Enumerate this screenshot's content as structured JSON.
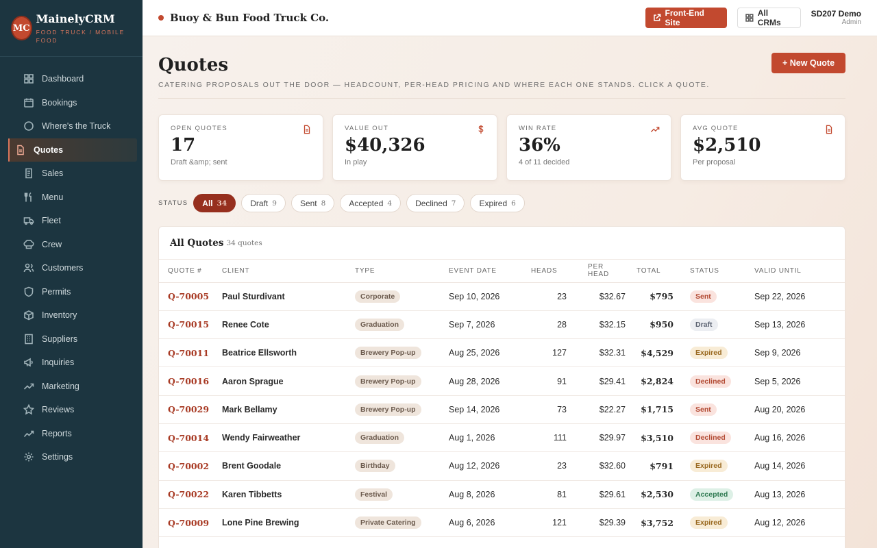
{
  "brand": {
    "logo": "MC",
    "name": "MainelyCRM",
    "subtitle": "Food Truck / Mobile Food"
  },
  "nav": [
    {
      "label": "Dashboard",
      "icon": "grid-icon"
    },
    {
      "label": "Bookings",
      "icon": "calendar-icon"
    },
    {
      "label": "Where's the Truck",
      "icon": "circle-icon"
    },
    {
      "label": "Quotes",
      "icon": "document-icon",
      "active": true
    },
    {
      "label": "Sales",
      "icon": "receipt-icon"
    },
    {
      "label": "Menu",
      "icon": "utensils-icon"
    },
    {
      "label": "Fleet",
      "icon": "truck-icon"
    },
    {
      "label": "Crew",
      "icon": "chef-hat-icon"
    },
    {
      "label": "Customers",
      "icon": "users-icon"
    },
    {
      "label": "Permits",
      "icon": "shield-icon"
    },
    {
      "label": "Inventory",
      "icon": "box-icon"
    },
    {
      "label": "Suppliers",
      "icon": "building-icon"
    },
    {
      "label": "Inquiries",
      "icon": "megaphone-icon"
    },
    {
      "label": "Marketing",
      "icon": "trend-icon"
    },
    {
      "label": "Reviews",
      "icon": "star-icon"
    },
    {
      "label": "Reports",
      "icon": "chart-icon"
    },
    {
      "label": "Settings",
      "icon": "gear-icon"
    }
  ],
  "topbar": {
    "business": "Buoy & Bun Food Truck Co.",
    "frontend_label": "Front-End Site",
    "allcrms_label": "All CRMs",
    "user_name": "SD207 Demo",
    "user_role": "Admin"
  },
  "page": {
    "title": "Quotes",
    "subtitle": "Catering proposals out the door — headcount, per-head pricing and where each one stands. Click a quote.",
    "new_button": "+ New Quote"
  },
  "stats": [
    {
      "label": "Open Quotes",
      "value": "17",
      "note": "Draft &amp; sent",
      "icon": "document-icon"
    },
    {
      "label": "Value Out",
      "value": "$40,326",
      "note": "In play",
      "icon": "dollar-icon"
    },
    {
      "label": "Win Rate",
      "value": "36%",
      "note": "4 of 11 decided",
      "icon": "trend-icon"
    },
    {
      "label": "Avg Quote",
      "value": "$2,510",
      "note": "Per proposal",
      "icon": "document-icon"
    }
  ],
  "filters": {
    "label": "STATUS",
    "items": [
      {
        "label": "All",
        "count": "34",
        "active": true
      },
      {
        "label": "Draft",
        "count": "9"
      },
      {
        "label": "Sent",
        "count": "8"
      },
      {
        "label": "Accepted",
        "count": "4"
      },
      {
        "label": "Declined",
        "count": "7"
      },
      {
        "label": "Expired",
        "count": "6"
      }
    ]
  },
  "table": {
    "title": "All Quotes",
    "count_label": "34 quotes",
    "columns": [
      "Quote #",
      "Client",
      "Type",
      "Event Date",
      "Heads",
      "Per Head",
      "Total",
      "Status",
      "Valid Until"
    ],
    "rows": [
      {
        "id": "Q-70005",
        "client": "Paul Sturdivant",
        "type": "Corporate",
        "date": "Sep 10, 2026",
        "heads": "23",
        "per_head": "$32.67",
        "total": "$795",
        "status": "Sent",
        "valid": "Sep 22, 2026"
      },
      {
        "id": "Q-70015",
        "client": "Renee Cote",
        "type": "Graduation",
        "date": "Sep 7, 2026",
        "heads": "28",
        "per_head": "$32.15",
        "total": "$950",
        "status": "Draft",
        "valid": "Sep 13, 2026"
      },
      {
        "id": "Q-70011",
        "client": "Beatrice Ellsworth",
        "type": "Brewery Pop-up",
        "date": "Aug 25, 2026",
        "heads": "127",
        "per_head": "$32.31",
        "total": "$4,529",
        "status": "Expired",
        "valid": "Sep 9, 2026"
      },
      {
        "id": "Q-70016",
        "client": "Aaron Sprague",
        "type": "Brewery Pop-up",
        "date": "Aug 28, 2026",
        "heads": "91",
        "per_head": "$29.41",
        "total": "$2,824",
        "status": "Declined",
        "valid": "Sep 5, 2026"
      },
      {
        "id": "Q-70029",
        "client": "Mark Bellamy",
        "type": "Brewery Pop-up",
        "date": "Sep 14, 2026",
        "heads": "73",
        "per_head": "$22.27",
        "total": "$1,715",
        "status": "Sent",
        "valid": "Aug 20, 2026"
      },
      {
        "id": "Q-70014",
        "client": "Wendy Fairweather",
        "type": "Graduation",
        "date": "Aug 1, 2026",
        "heads": "111",
        "per_head": "$29.97",
        "total": "$3,510",
        "status": "Declined",
        "valid": "Aug 16, 2026"
      },
      {
        "id": "Q-70002",
        "client": "Brent Goodale",
        "type": "Birthday",
        "date": "Aug 12, 2026",
        "heads": "23",
        "per_head": "$32.60",
        "total": "$791",
        "status": "Expired",
        "valid": "Aug 14, 2026"
      },
      {
        "id": "Q-70022",
        "client": "Karen Tibbetts",
        "type": "Festival",
        "date": "Aug 8, 2026",
        "heads": "81",
        "per_head": "$29.61",
        "total": "$2,530",
        "status": "Accepted",
        "valid": "Aug 13, 2026"
      },
      {
        "id": "Q-70009",
        "client": "Lone Pine Brewing",
        "type": "Private Catering",
        "date": "Aug 6, 2026",
        "heads": "121",
        "per_head": "$29.39",
        "total": "$3,752",
        "status": "Expired",
        "valid": "Aug 12, 2026"
      }
    ]
  },
  "colors": {
    "accent": "#c2492f",
    "sidebar": "#1c3540",
    "active_pill": "#962f1e"
  }
}
